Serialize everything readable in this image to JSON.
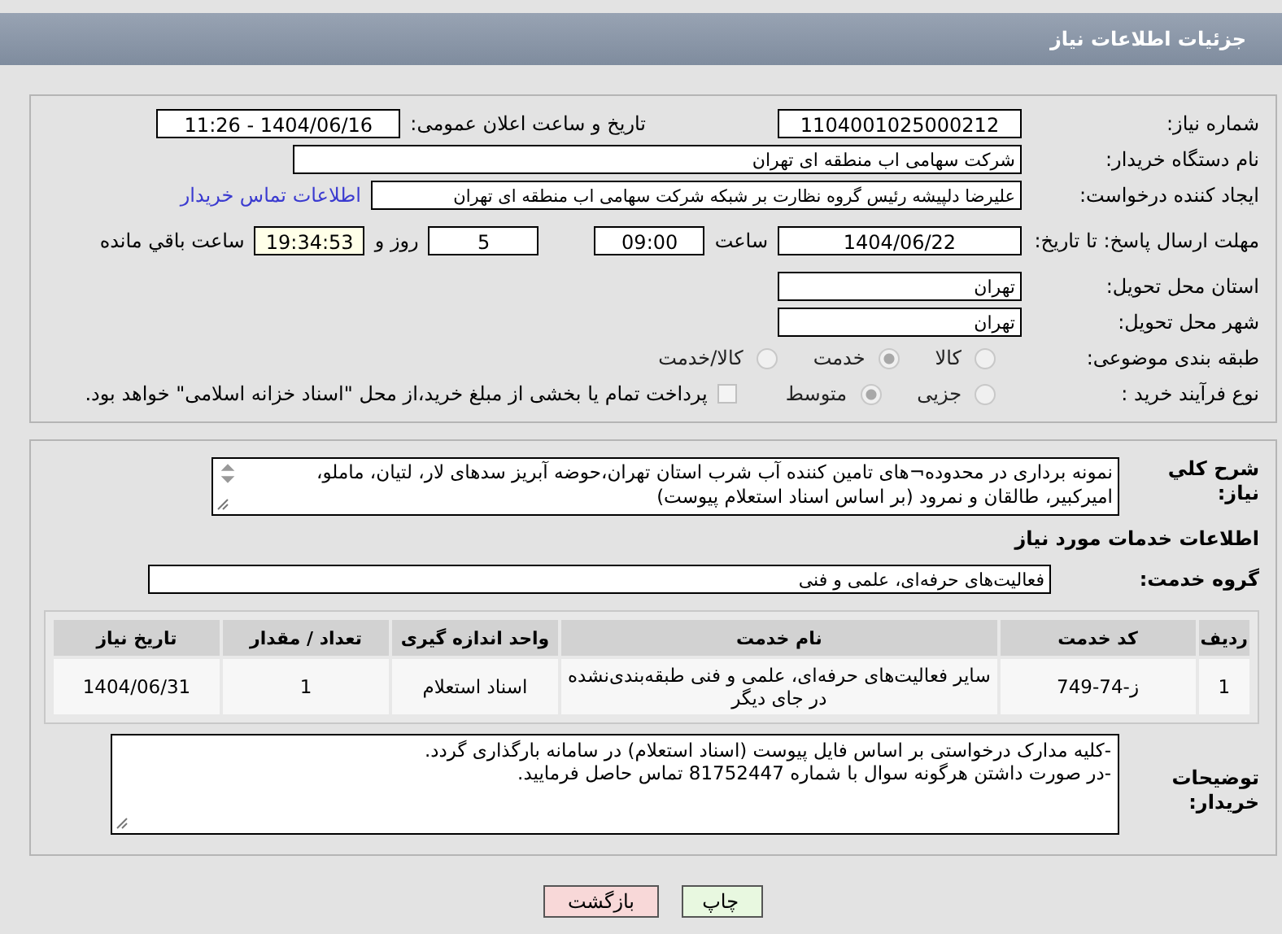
{
  "header": {
    "title": "جزئیات اطلاعات نیاز"
  },
  "need_number": {
    "label": "شماره نیاز:",
    "value": "1104001025000212"
  },
  "announce_datetime": {
    "label": "تاریخ و ساعت اعلان عمومی:",
    "value": "1404/06/16 - 11:26"
  },
  "buyer_org": {
    "label": "نام دستگاه خریدار:",
    "value": "شرکت سهامی اب منطقه ای تهران"
  },
  "requester": {
    "label": "ایجاد کننده درخواست:",
    "value": "علیرضا دلپیشه رئیس گروه نظارت بر شبکه شرکت سهامی اب منطقه ای تهران",
    "link": "اطلاعات تماس خریدار"
  },
  "deadline": {
    "label": "مهلت ارسال پاسخ: تا تاریخ:",
    "date": "1404/06/22",
    "time_label": "ساعت",
    "time": "09:00",
    "days": "5",
    "days_label": "روز و",
    "remaining": "19:34:53",
    "remaining_label": "ساعت باقي مانده"
  },
  "province": {
    "label": "استان محل تحویل:",
    "value": "تهران"
  },
  "city": {
    "label": "شهر محل تحویل:",
    "value": "تهران"
  },
  "category": {
    "label": "طبقه بندی موضوعی:",
    "options": [
      {
        "label": "کالا",
        "selected": false
      },
      {
        "label": "خدمت",
        "selected": true
      },
      {
        "label": "کالا/خدمت",
        "selected": false
      }
    ]
  },
  "process": {
    "label": "نوع فرآیند خرید :",
    "options": [
      {
        "label": "جزیی",
        "selected": false
      },
      {
        "label": "متوسط",
        "selected": true
      }
    ],
    "treasury": {
      "checked": false,
      "text": "پرداخت تمام یا بخشی از مبلغ خرید،از محل \"اسناد خزانه اسلامی\" خواهد بود."
    }
  },
  "description": {
    "label": "شرح کلي نیاز:",
    "text": "نمونه برداری در محدوده¬های تامین کننده آب شرب استان تهران،حوضه آبریز سدهای لار، لتیان، ماملو، امیرکبیر، طالقان و نمرود (بر اساس اسناد استعلام پیوست)"
  },
  "services_heading": "اطلاعات خدمات مورد نیاز",
  "service_group": {
    "label": "گروه خدمت:",
    "value": "فعالیت‌های حرفه‌ای، علمی و فنی"
  },
  "table": {
    "columns": [
      "ردیف",
      "کد خدمت",
      "نام خدمت",
      "واحد اندازه گیری",
      "تعداد / مقدار",
      "تاریخ نیاز"
    ],
    "rows": [
      [
        "1",
        "ز-74-749",
        "سایر فعالیت‌های حرفه‌ای، علمی و فنی طبقه‌بندی‌نشده در جای دیگر",
        "اسناد استعلام",
        "1",
        "1404/06/31"
      ]
    ]
  },
  "buyer_notes": {
    "label": "توضیحات خریدار:",
    "lines": [
      "-کلیه مدارک درخواستی بر اساس فایل پیوست (اسناد استعلام) در سامانه بارگذاری گردد.",
      "-در صورت داشتن هرگونه سوال با شماره 81752447 تماس حاصل فرمایید."
    ]
  },
  "buttons": [
    {
      "kind": "print",
      "label": "چاپ"
    },
    {
      "kind": "back",
      "label": "بازگشت"
    }
  ]
}
